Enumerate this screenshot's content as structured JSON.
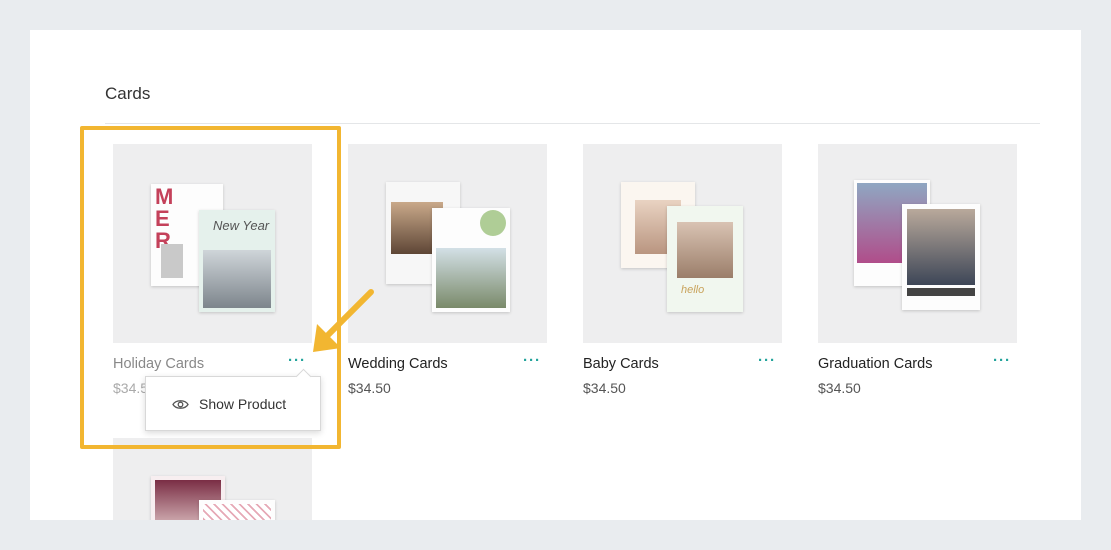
{
  "section": {
    "title": "Cards"
  },
  "cards": [
    {
      "name": "Holiday Cards",
      "price": "$34.50",
      "more_icon": "more-dots-icon"
    },
    {
      "name": "Wedding Cards",
      "price": "$34.50",
      "more_icon": "more-dots-icon"
    },
    {
      "name": "Baby Cards",
      "price": "$34.50",
      "more_icon": "more-dots-icon"
    },
    {
      "name": "Graduation Cards",
      "price": "$34.50",
      "more_icon": "more-dots-icon"
    }
  ],
  "dropdown": {
    "item_label": "Show Product",
    "item_icon": "eye-icon"
  },
  "colors": {
    "accent": "#21a39b",
    "highlight": "#f2b631",
    "background": "#e9ecef"
  }
}
